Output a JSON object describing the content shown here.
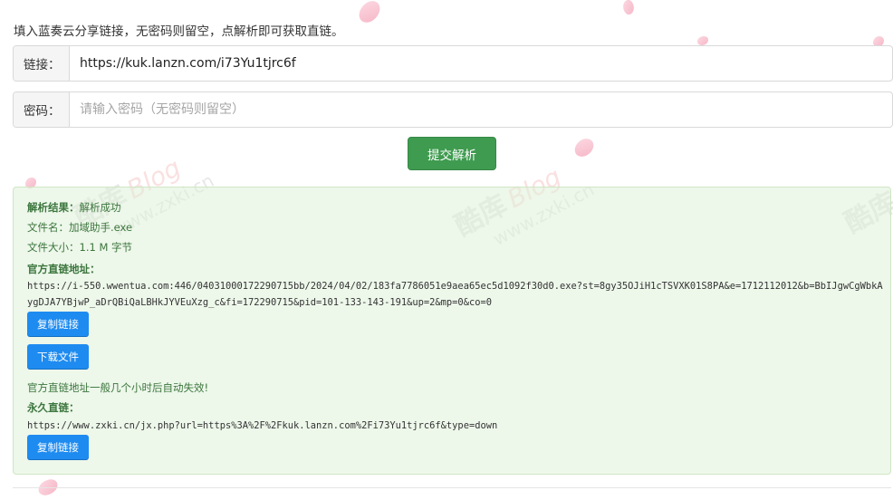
{
  "instruction": "填入蓝奏云分享链接，无密码则留空，点解析即可获取直链。",
  "link_field": {
    "label": "链接：",
    "value": "https://kuk.lanzn.com/i73Yu1tjrc6f"
  },
  "password_field": {
    "label": "密码：",
    "value": "",
    "placeholder": "请输入密码（无密码则留空）"
  },
  "submit_label": "提交解析",
  "watermark": {
    "name": "酷库",
    "blog": "Blog",
    "domain": "www.zxki.cn"
  },
  "result": {
    "status_label": "解析结果：",
    "status_value": "解析成功",
    "filename_label": "文件名：",
    "filename_value": "加域助手.exe",
    "filesize_label": "文件大小：",
    "filesize_value": "1.1 M 字节",
    "official_label": "官方直链地址：",
    "official_url": "https://i-550.wwentua.com:446/04031000172290715bb/2024/04/02/183fa7786051e9aea65ec5d1092f30d0.exe?st=8gy35OJiH1cTSVXK01S8PA&e=1712112012&b=BbIJgwCgWbkAygDJA7YBjwP_aDrQBiQaLBHkJYVEuXzg_c&fi=172290715&pid=101-133-143-191&up=2&mp=0&co=0",
    "copy_label": "复制链接",
    "download_label": "下载文件",
    "expire_note": "官方直链地址一般几个小时后自动失效!",
    "permanent_label": "永久直链：",
    "permanent_url": "https://www.zxki.cn/jx.php?url=https%3A%2F%2Fkuk.lanzn.com%2Fi73Yu1tjrc6f&type=down",
    "copy2_label": "复制链接"
  },
  "colors": {
    "submit": "#3e9b4f",
    "button": "#1e8bf0",
    "result_bg": "#dff0d8",
    "result_text": "#3c763d"
  }
}
